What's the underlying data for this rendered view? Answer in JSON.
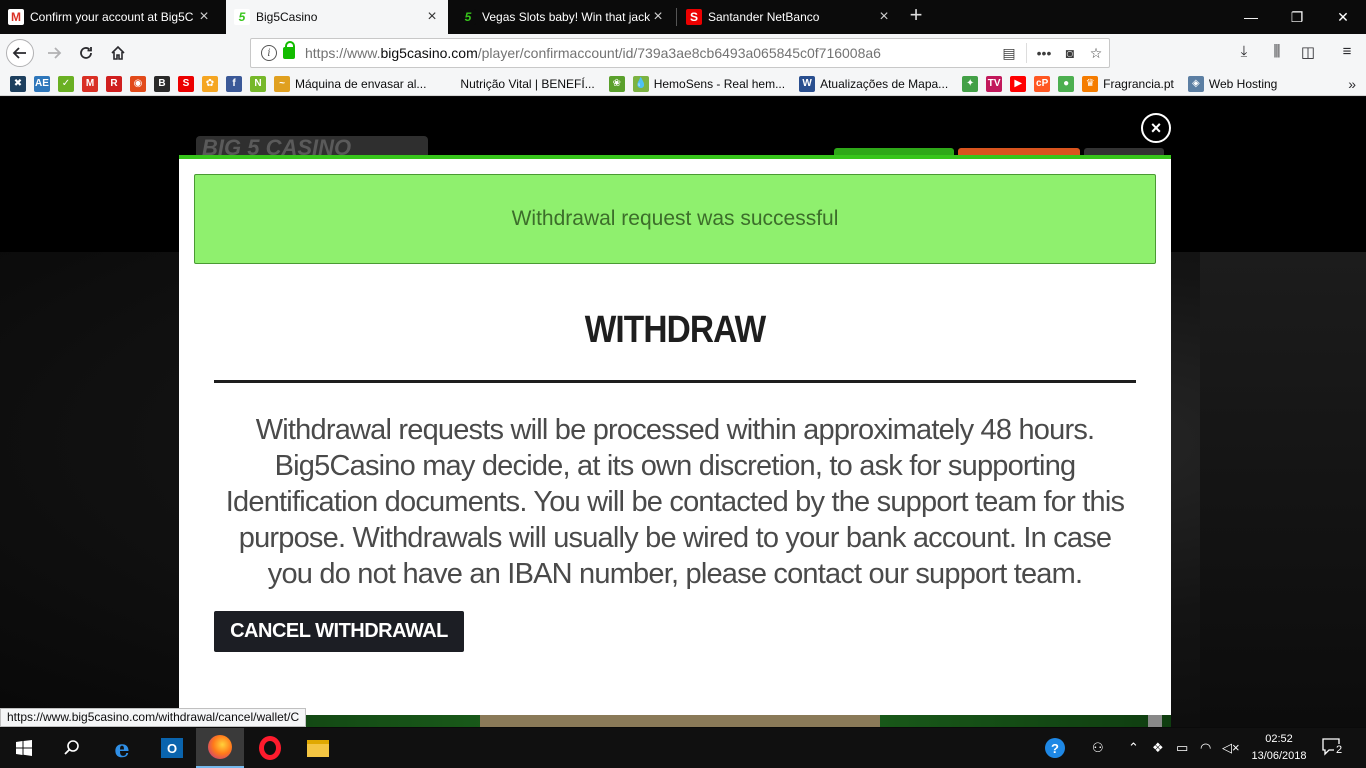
{
  "browser": {
    "tabs": [
      {
        "label": "Confirm your account at Big5C",
        "favicon": "gmail-icon",
        "color": "#d93025",
        "glyph": "M",
        "active": false
      },
      {
        "label": "Big5Casino",
        "favicon": "big5-icon",
        "color": "#37c51b",
        "glyph": "5",
        "active": true
      },
      {
        "label": "Vegas Slots baby! Win that jack",
        "favicon": "big5-icon",
        "color": "#37c51b",
        "glyph": "5",
        "active": false
      },
      {
        "label": "Santander NetBanco",
        "favicon": "santander-icon",
        "color": "#ec0000",
        "glyph": "S",
        "active": false
      }
    ],
    "new_tab_symbol": "+",
    "window_controls": {
      "minimize": "—",
      "maximize": "❐",
      "close": "✕"
    },
    "url": {
      "prefix": "https://www.",
      "host": "big5casino.com",
      "path": "/player/confirmaccount/id/739a3ae8cb6493a065845c0f716008a6"
    },
    "bookmarks": [
      {
        "label": "",
        "icon": "bookmark-icon-1",
        "color": "#1d3f5e",
        "glyph": "✖"
      },
      {
        "label": "",
        "icon": "amex-icon",
        "color": "#2e77bb",
        "glyph": "AE"
      },
      {
        "label": "",
        "icon": "check-icon",
        "color": "#6ab023",
        "glyph": "✓"
      },
      {
        "label": "",
        "icon": "gmail-icon",
        "color": "#d93025",
        "glyph": "M"
      },
      {
        "label": "",
        "icon": "r-icon",
        "color": "#d01f1f",
        "glyph": "R"
      },
      {
        "label": "",
        "icon": "bookmark-icon-2",
        "color": "#e24a1a",
        "glyph": "◉"
      },
      {
        "label": "",
        "icon": "bookmark-icon-3",
        "color": "#2a2a2a",
        "glyph": "B"
      },
      {
        "label": "",
        "icon": "santander-icon",
        "color": "#ec0000",
        "glyph": "S"
      },
      {
        "label": "",
        "icon": "bookmark-icon-4",
        "color": "#f5a623",
        "glyph": "✿"
      },
      {
        "label": "",
        "icon": "facebook-icon",
        "color": "#3b5998",
        "glyph": "f"
      },
      {
        "label": "",
        "icon": "n-icon",
        "color": "#76b82a",
        "glyph": "N"
      },
      {
        "label": "Máquina de envasar al...",
        "icon": "mustache-icon",
        "color": "#e0a020",
        "glyph": "~"
      },
      {
        "label": "Nutrição Vital | BENEFÍ...",
        "icon": "",
        "color": "",
        "glyph": ""
      },
      {
        "label": "",
        "icon": "leaf-icon",
        "color": "#5aa02c",
        "glyph": "❀"
      },
      {
        "label": "HemoSens - Real hem...",
        "icon": "drop-icon",
        "color": "#7cb342",
        "glyph": "💧"
      },
      {
        "label": "Atualizações de Mapa...",
        "icon": "vw-icon",
        "color": "#2a4f8f",
        "glyph": "W"
      },
      {
        "label": "",
        "icon": "bookmark-icon-5",
        "color": "#43a047",
        "glyph": "✦"
      },
      {
        "label": "",
        "icon": "iptv-icon",
        "color": "#c2185b",
        "glyph": "TV"
      },
      {
        "label": "",
        "icon": "youtube-icon",
        "color": "#ff0000",
        "glyph": "▶"
      },
      {
        "label": "",
        "icon": "cp-icon",
        "color": "#ff5722",
        "glyph": "cP"
      },
      {
        "label": "",
        "icon": "green-dot-icon",
        "color": "#4caf50",
        "glyph": "●"
      },
      {
        "label": "Fragrancia.pt",
        "icon": "crown-icon",
        "color": "#f57c00",
        "glyph": "♛"
      },
      {
        "label": "Web Hosting",
        "icon": "diamond-icon",
        "color": "#5c7fa3",
        "glyph": "◈"
      }
    ],
    "bookmarks_more": "»",
    "status_url": "https://www.big5casino.com/withdrawal/cancel/wallet/C"
  },
  "modal": {
    "alert": "Withdrawal request was successful",
    "title": "WITHDRAW",
    "body": "Withdrawal requests will be processed within approximately 48 hours. Big5Casino may decide, at its own discretion, to ask for supporting Identification documents. You will be contacted by the support team for this purpose. Withdrawals will usually be wired to your bank account. In case you do not have an IBAN number, please contact our support team.",
    "cancel_button": "CANCEL WITHDRAWAL",
    "close_symbol": "×"
  },
  "taskbar": {
    "time": "02:52",
    "date": "13/06/2018",
    "notification_count": "2"
  },
  "colors": {
    "brand_green": "#37c51b",
    "alert_bg": "#8ff06e",
    "button_dark": "#1c1e24"
  }
}
